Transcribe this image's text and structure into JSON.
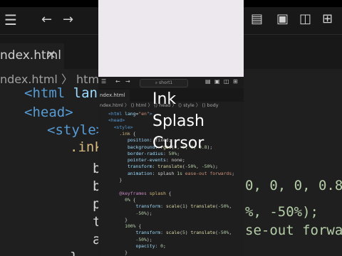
{
  "overlay": {
    "title_lines": [
      "Ink",
      "Splash",
      "Cursor"
    ]
  },
  "background_editor": {
    "tab_label": "ndex.html",
    "tab_close": "×",
    "breadcrumb": "ndex.html  〉  html",
    "code_lines": [
      {
        "parts": [
          [
            "tag",
            "<html "
          ],
          [
            "attr",
            "lang"
          ],
          [
            "plain",
            "="
          ],
          [
            "str",
            "\""
          ]
        ]
      },
      {
        "parts": [
          [
            "tag",
            "<head>"
          ]
        ]
      },
      {
        "parts": [
          [
            "tag",
            "<style>"
          ]
        ]
      },
      {
        "parts": [
          [
            "sel",
            ".ink"
          ]
        ]
      },
      {
        "parts": [
          [
            "plain",
            "b"
          ]
        ]
      },
      {
        "parts": [
          [
            "plain",
            "b"
          ]
        ]
      },
      {
        "parts": [
          [
            "plain",
            "p"
          ]
        ]
      },
      {
        "parts": [
          [
            "plain",
            "t"
          ]
        ]
      },
      {
        "parts": [
          [
            "plain",
            "a"
          ]
        ]
      },
      {
        "parts": [
          [
            "plain",
            "}"
          ]
        ]
      }
    ],
    "right_fragments": [
      "0, 0, 0, 0.8);",
      "%, -50%);",
      "se-out forwards;"
    ]
  },
  "editor": {
    "search_placeholder": "short1",
    "tab_label": "ndex.html",
    "breadcrumb": "ndex.html 〉 ⟨⟩ html 〉 ⟨⟩ head 〉 ⟨⟩ style 〉 ⟨⟩ body",
    "code": [
      [
        [
          "tag",
          "<html "
        ],
        [
          "attr",
          "lang"
        ],
        [
          "plain",
          "="
        ],
        [
          "str",
          "\"en\""
        ],
        [
          "tag",
          ">"
        ]
      ],
      [
        [
          "tag",
          "<head>"
        ]
      ],
      [
        [
          "plain",
          "  "
        ],
        [
          "tag",
          "<style>"
        ]
      ],
      [
        [
          "plain",
          "    "
        ],
        [
          "sel",
          ".ink"
        ],
        [
          "plain",
          " {"
        ]
      ],
      [
        [
          "plain",
          "       "
        ],
        [
          "prop",
          "position"
        ],
        [
          "plain",
          ": fixed;"
        ]
      ],
      [
        [
          "plain",
          "       "
        ],
        [
          "prop",
          "background"
        ],
        [
          "plain",
          ": "
        ],
        [
          "fn",
          "rgba"
        ],
        [
          "plain",
          "("
        ],
        [
          "num",
          "0, 0, 0, 0.8"
        ],
        [
          "plain",
          ");"
        ]
      ],
      [
        [
          "plain",
          "       "
        ],
        [
          "prop",
          "border-radius"
        ],
        [
          "plain",
          ": "
        ],
        [
          "num",
          "50%"
        ],
        [
          "plain",
          ";"
        ]
      ],
      [
        [
          "plain",
          "       "
        ],
        [
          "prop",
          "pointer-events"
        ],
        [
          "plain",
          ": none;"
        ]
      ],
      [
        [
          "plain",
          "       "
        ],
        [
          "prop",
          "transform"
        ],
        [
          "plain",
          ": "
        ],
        [
          "fn",
          "translate"
        ],
        [
          "plain",
          "("
        ],
        [
          "num",
          "-50%, -50%"
        ],
        [
          "plain",
          ");"
        ]
      ],
      [
        [
          "plain",
          "       "
        ],
        [
          "prop",
          "animation"
        ],
        [
          "plain",
          ": splash "
        ],
        [
          "num",
          "1s"
        ],
        [
          "plain",
          " "
        ],
        [
          "str",
          "ease-out forwards"
        ],
        [
          "plain",
          ";"
        ]
      ],
      [
        [
          "plain",
          "    }"
        ]
      ],
      [
        [
          "plain",
          ""
        ]
      ],
      [
        [
          "plain",
          "    "
        ],
        [
          "kw",
          "@keyframes"
        ],
        [
          "plain",
          " "
        ],
        [
          "sel",
          "splash"
        ],
        [
          "plain",
          " {"
        ]
      ],
      [
        [
          "plain",
          "      "
        ],
        [
          "num",
          "0%"
        ],
        [
          "plain",
          " {"
        ]
      ],
      [
        [
          "plain",
          "          "
        ],
        [
          "prop",
          "transform"
        ],
        [
          "plain",
          ": "
        ],
        [
          "fn",
          "scale"
        ],
        [
          "plain",
          "("
        ],
        [
          "num",
          "1"
        ],
        [
          "plain",
          ") "
        ],
        [
          "fn",
          "translate"
        ],
        [
          "plain",
          "("
        ],
        [
          "num",
          "-50%"
        ],
        [
          "plain",
          ","
        ]
      ],
      [
        [
          "plain",
          "          "
        ],
        [
          "num",
          "-50%"
        ],
        [
          "plain",
          ");"
        ]
      ],
      [
        [
          "plain",
          "      }"
        ]
      ],
      [
        [
          "plain",
          "      "
        ],
        [
          "num",
          "100%"
        ],
        [
          "plain",
          " {"
        ]
      ],
      [
        [
          "plain",
          "          "
        ],
        [
          "prop",
          "transform"
        ],
        [
          "plain",
          ": "
        ],
        [
          "fn",
          "scale"
        ],
        [
          "plain",
          "("
        ],
        [
          "num",
          "5"
        ],
        [
          "plain",
          ") "
        ],
        [
          "fn",
          "translate"
        ],
        [
          "plain",
          "("
        ],
        [
          "num",
          "-50%"
        ],
        [
          "plain",
          ","
        ]
      ],
      [
        [
          "plain",
          "          "
        ],
        [
          "num",
          "-50%"
        ],
        [
          "plain",
          ");"
        ]
      ],
      [
        [
          "plain",
          "          "
        ],
        [
          "prop",
          "opacity"
        ],
        [
          "plain",
          ": "
        ],
        [
          "num",
          "0"
        ],
        [
          "plain",
          ";"
        ]
      ],
      [
        [
          "plain",
          "      }"
        ]
      ]
    ]
  }
}
